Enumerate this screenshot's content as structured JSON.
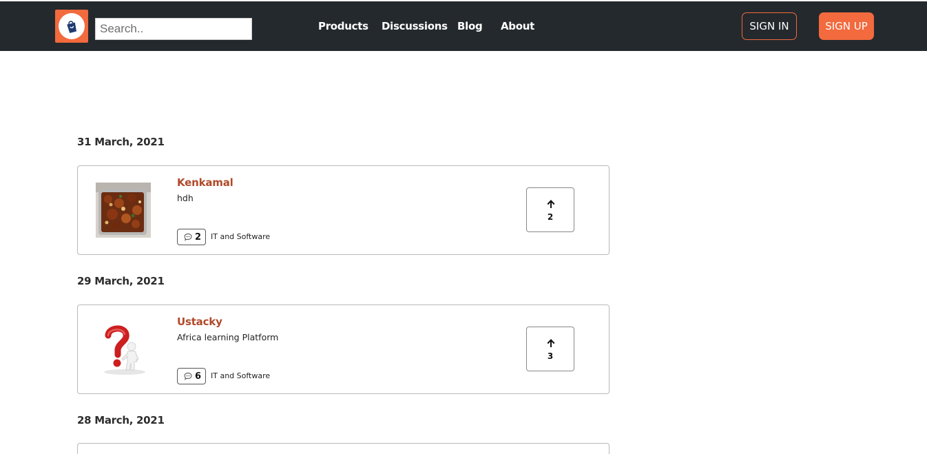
{
  "header": {
    "logo_icon": "shopping-bag-icon",
    "search_placeholder": "Search..",
    "nav": [
      {
        "label": "Products"
      },
      {
        "label": "Discussions"
      },
      {
        "label": "Blog"
      },
      {
        "label": "About"
      }
    ],
    "signin_label": "SIGN IN",
    "signup_label": "SIGN UP"
  },
  "colors": {
    "accent": "#f26a3d",
    "navbar_bg": "#24292d",
    "product_name": "#b04a2a"
  },
  "groups": [
    {
      "date": "31 March, 2021",
      "product": {
        "name": "Kenkamal",
        "description": "hdh",
        "comments": "2",
        "category": "IT and Software",
        "upvotes": "2",
        "thumbnail": "food-tray-image"
      }
    },
    {
      "date": "29 March, 2021",
      "product": {
        "name": "Ustacky",
        "description": "Africa learning Platform",
        "comments": "6",
        "category": "IT and Software",
        "upvotes": "3",
        "thumbnail": "question-mark-figure-image"
      }
    },
    {
      "date": "28 March, 2021"
    }
  ]
}
